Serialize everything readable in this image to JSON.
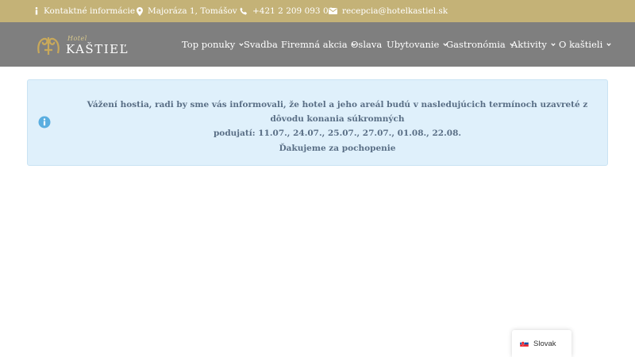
{
  "topbar": {
    "contact": "Kontaktné informácie",
    "address": "Majoráza 1, Tomášov",
    "phone": "+421 2 209 093 00",
    "email": "recepcia@hotelkastiel.sk"
  },
  "logo": {
    "script": "Hotel",
    "name": "KAŠTIEĽ"
  },
  "menu": [
    {
      "label": "Top ponuky",
      "has_dropdown": true
    },
    {
      "label": "Svadba",
      "has_dropdown": false
    },
    {
      "label": "Firemná akcia",
      "has_dropdown": true
    },
    {
      "label": "Oslava",
      "has_dropdown": false
    },
    {
      "label": "Ubytovanie",
      "has_dropdown": true
    },
    {
      "label": "Gastronómia",
      "has_dropdown": true
    },
    {
      "label": "Aktivity",
      "has_dropdown": true
    },
    {
      "label": "O kaštieli",
      "has_dropdown": true
    }
  ],
  "notice": {
    "line1": "Vážení hostia, radi by sme vás informovali, že hotel a jeho areál budú v nasledujúcich termínoch uzavreté z dôvodu konania súkromných",
    "line2": "podujatí: 11.07., 24.07., 25.07., 27.07., 01.08., 22.08.",
    "thanks": "Ďakujeme za pochopenie"
  },
  "language": {
    "selected": "Slovak"
  },
  "colors": {
    "topbar": "#c4b277",
    "navbar": "#7f7f7f",
    "notice_bg": "#dff0fb",
    "notice_text": "#5a6f86",
    "info_icon": "#5aaee0"
  }
}
